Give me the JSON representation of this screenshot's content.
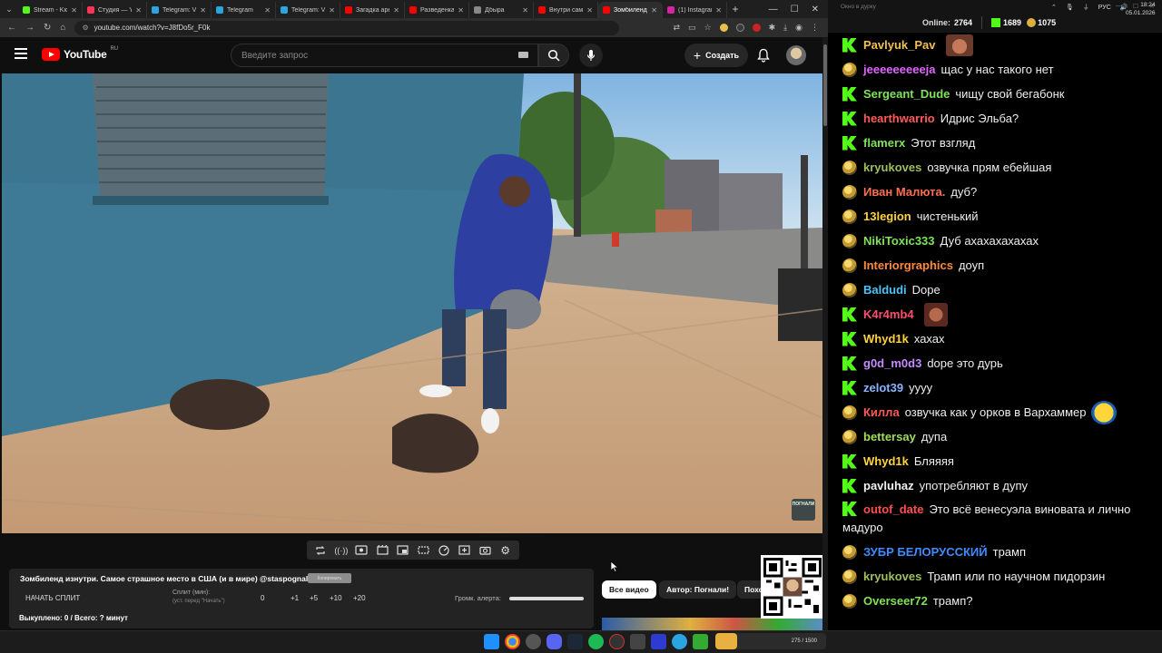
{
  "browser": {
    "tabs": [
      {
        "title": "Stream - Kick",
        "color": "#53fc18"
      },
      {
        "title": "Студия — YouTube",
        "color": "#ff3355"
      },
      {
        "title": "Telegram: View",
        "color": "#2aa5e0"
      },
      {
        "title": "Telegram",
        "color": "#2aa5e0"
      },
      {
        "title": "Telegram: View",
        "color": "#2aa5e0"
      },
      {
        "title": "Загадка арестованного",
        "color": "#ff0000"
      },
      {
        "title": "Разведенка",
        "color": "#ff0000"
      },
      {
        "title": "Дбыра",
        "color": "#888888"
      },
      {
        "title": "Внутри самой",
        "color": "#ff0000"
      },
      {
        "title": "Зомбиленд",
        "color": "#ff0000"
      },
      {
        "title": "(1) Instagram",
        "color": "#d6249f"
      }
    ],
    "active_tab": 9,
    "url": "youtube.com/watch?v=J8fDo5r_F0k"
  },
  "youtube": {
    "logo_text": "YouTube",
    "region": "RU",
    "search_placeholder": "Введите запрос",
    "create_label": "Создать"
  },
  "video": {
    "badge_text": "ПОГНАЛИ"
  },
  "panel": {
    "title": "Зомбиленд изнутри. Самое страшное место в США (и в мире) @staspognali",
    "tag": "Копировать",
    "split_button": "НАЧАТЬ СПЛИТ",
    "split_label": "Сплит (мин):",
    "split_sub": "(уст. перед \"Начать\")",
    "split_values": [
      "0",
      "+1",
      "+5",
      "+10",
      "+20"
    ],
    "alert_label": "Громк. алерта:",
    "alert_volume": 1.0,
    "bought": "Выкуплено: 0 / Всего: ? минут"
  },
  "chips": {
    "all": "Все видео",
    "author": "Автор: Погнали!",
    "similar": "Похожие"
  },
  "chat": {
    "window_title": "Окно в дурку",
    "online_label": "Online:",
    "online": "2764",
    "kick_count": "1689",
    "coins": "1075",
    "messages": [
      {
        "user": "Pavlyuk_Pav",
        "color": "#f0c050",
        "badge": "kick",
        "text": "",
        "emote": "face1"
      },
      {
        "user": "jeeeeeeeeeja",
        "color": "#e066ff",
        "badge": "pog",
        "text": "щас у нас такого нет"
      },
      {
        "user": "Sergeant_Dude",
        "color": "#7fe35a",
        "badge": "kick",
        "text": "чищу свой бегабонк"
      },
      {
        "user": "hearthwarrio",
        "color": "#ff5a5a",
        "badge": "kick",
        "text": "Идрис Эльба?"
      },
      {
        "user": "flamerx",
        "color": "#7fe35a",
        "badge": "kick",
        "text": "Этот взгляд"
      },
      {
        "user": "kryukoves",
        "color": "#9fbf5a",
        "badge": "pog",
        "text": "озвучка прям ебейшая"
      },
      {
        "user": "Иван Малюта.",
        "color": "#ff6f4f",
        "badge": "pog",
        "text": "дуб?"
      },
      {
        "user": "13legion",
        "color": "#ffd23f",
        "badge": "pog",
        "text": "чистенький"
      },
      {
        "user": "NikiToxic333",
        "color": "#7fe35a",
        "badge": "pog",
        "text": "Дуб ахахахахахах"
      },
      {
        "user": "Interiorgraphics",
        "color": "#ff8a3d",
        "badge": "pog",
        "text": "доуп"
      },
      {
        "user": "Baldudi",
        "color": "#4fc3f7",
        "badge": "pog",
        "text": "Dope"
      },
      {
        "user": "K4r4mb4",
        "color": "#ff4f6f",
        "badge": "kick",
        "text": "",
        "emote": "face2"
      },
      {
        "user": "Whyd1k",
        "color": "#ffd23f",
        "badge": "kick",
        "text": "хахах"
      },
      {
        "user": "g0d_m0d3",
        "color": "#c58bff",
        "badge": "kick",
        "text": "dope это дурь"
      },
      {
        "user": "zelot39",
        "color": "#8ab4ff",
        "badge": "kick",
        "text": "yyyy"
      },
      {
        "user": "Килла",
        "color": "#ff5a5a",
        "badge": "pog",
        "text": "озвучка как у орков в Вархаммер",
        "emote": "laugh"
      },
      {
        "user": "bettersay",
        "color": "#9fdf5a",
        "badge": "pog",
        "text": "дупа"
      },
      {
        "user": "Whyd1k",
        "color": "#ffd23f",
        "badge": "kick",
        "text": "Бляяяя"
      },
      {
        "user": "pavluhaz",
        "color": "#f0f0f0",
        "badge": "kick",
        "text": "употребляют в дупу"
      },
      {
        "user": "outof_date",
        "color": "#ff4f4f",
        "badge": "kick",
        "text": "Это всё венесуэла виновата и лично мадуро",
        "wrap": true
      },
      {
        "user": "ЗУБР БЕЛОРУССКИЙ",
        "color": "#3f8cff",
        "badge": "pog",
        "text": "трамп"
      },
      {
        "user": "kryukoves",
        "color": "#9fbf5a",
        "badge": "pog",
        "text": "Трамп или по научном пидорзин"
      },
      {
        "user": "Overseer72",
        "color": "#7fe35a",
        "badge": "pog",
        "text": "трамп?"
      }
    ]
  },
  "taskbar": {
    "pill_text": "275 / 1500",
    "lang": "РУС",
    "time": "18:24",
    "date": "05.01.2026"
  }
}
